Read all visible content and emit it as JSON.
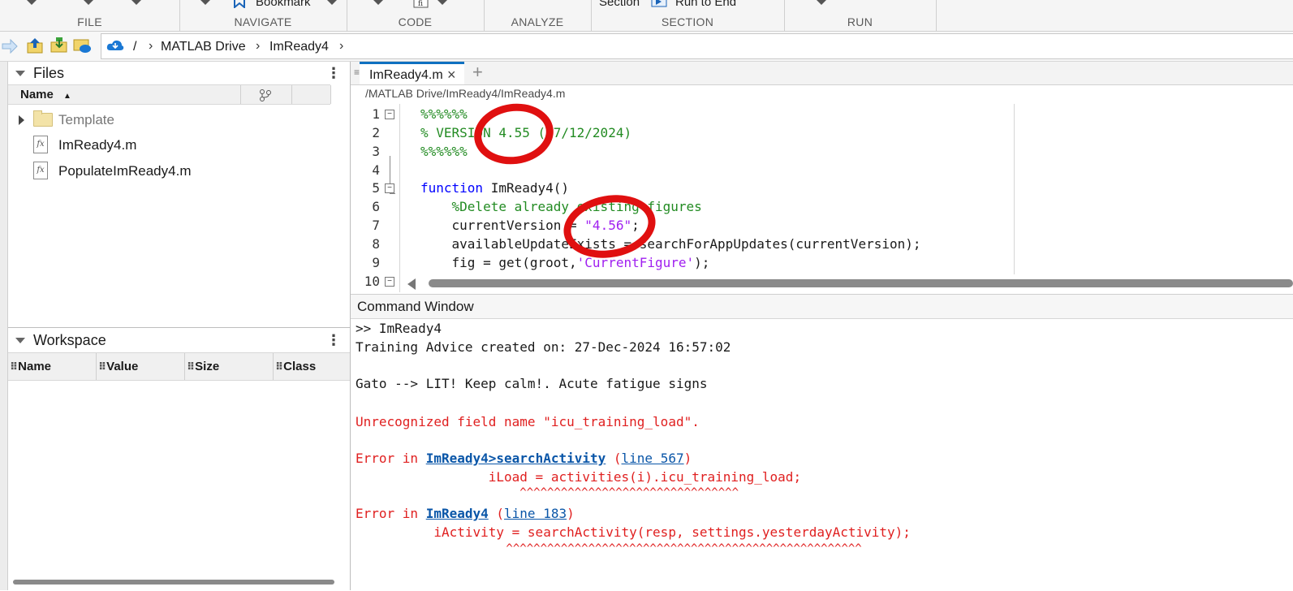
{
  "toolstrip": {
    "sections": [
      {
        "id": "file",
        "label": "FILE"
      },
      {
        "id": "navigate",
        "label": "NAVIGATE"
      },
      {
        "id": "code",
        "label": "CODE"
      },
      {
        "id": "analyze",
        "label": "ANALYZE"
      },
      {
        "id": "section",
        "label": "SECTION"
      },
      {
        "id": "run",
        "label": "RUN"
      }
    ],
    "bookmark_label": "Bookmark",
    "section_label": "Section",
    "run_to_end_label": "Run to End"
  },
  "address": {
    "root": "/",
    "crumbs": [
      "MATLAB Drive",
      "ImReady4"
    ]
  },
  "files_panel": {
    "title": "Files",
    "column_name": "Name",
    "items": [
      {
        "name": "Template",
        "type": "folder"
      },
      {
        "name": "ImReady4.m",
        "type": "function"
      },
      {
        "name": "PopulateImReady4.m",
        "type": "function"
      }
    ]
  },
  "workspace_panel": {
    "title": "Workspace",
    "columns": [
      "Name",
      "Value",
      "Size",
      "Class"
    ]
  },
  "editor": {
    "tab_label": "ImReady4.m",
    "file_path": "/MATLAB Drive/ImReady4/ImReady4.m",
    "line_numbers": [
      "1",
      "2",
      "3",
      "4",
      "5",
      "6",
      "7",
      "8",
      "9",
      "10"
    ],
    "lines": {
      "l1": "%%%%%%",
      "l2": "% VERSION 4.55 (27/12/2024)",
      "l3": "%%%%%%",
      "l5_kw": "function",
      "l5_rest": " ImReady4()",
      "l6": "    %Delete already existing figures",
      "l7_a": "    currentVersion = ",
      "l7_str": "\"4.56\"",
      "l7_b": ";",
      "l8": "    availableUpdateExists = searchForAppUpdates(currentVersion);",
      "l9_a": "    fig = get(groot,",
      "l9_str": "'CurrentFigure'",
      "l9_b": ");"
    }
  },
  "command_window": {
    "title": "Command Window",
    "prompt_line": ">> ImReady4",
    "line_advice": "Training Advice created on: 27-Dec-2024 16:57:02",
    "line_gato": "Gato --> LIT! Keep calm!. Acute fatigue signs",
    "line_error": "Unrecognized field name \"icu_training_load\".",
    "err1_prefix": "Error in ",
    "err1_func": "ImReady4>searchActivity",
    "err1_open": " (",
    "err1_line": "line 567",
    "err1_close": ")",
    "err1_code": "                 iLoad = activities(i).icu_training_load;",
    "err1_carets": "                        ^^^^^^^^^^^^^^^^^^^^^^^^^^^^^^^^",
    "err2_prefix": "Error in ",
    "err2_func": "ImReady4",
    "err2_open": " (",
    "err2_line": "line 183",
    "err2_close": ")",
    "err2_code": "          iActivity = searchActivity(resp, settings.yesterdayActivity);",
    "err2_carets": "                      ^^^^^^^^^^^^^^^^^^^^^^^^^^^^^^^^^^^^^^^^^^^^^^^^^^^^"
  },
  "colors": {
    "accent": "#0e70c0",
    "comment": "#228b22",
    "keyword": "#0000ff",
    "string": "#a020f0",
    "error": "#e02020",
    "annotation": "#e01010"
  }
}
